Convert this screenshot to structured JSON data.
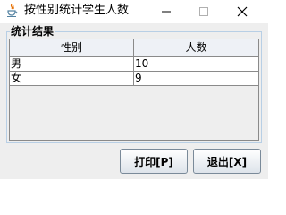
{
  "window": {
    "title": "按性别统计学生人数",
    "app_icon": "java-cup-icon",
    "controls": [
      "minimize-icon",
      "maximize-icon",
      "close-icon"
    ]
  },
  "group": {
    "label": "统计结果"
  },
  "table": {
    "columns": [
      "性别",
      "人数"
    ],
    "rows": [
      [
        "男",
        "10"
      ],
      [
        "女",
        "9"
      ]
    ]
  },
  "buttons": {
    "print_label": "打印[P]",
    "exit_label": "退出[X]"
  },
  "colors": {
    "panel_bg": "#eeeeee",
    "group_border": "#b8cfe5",
    "grid_line": "#8a8a8a",
    "java_red": "#e76f00",
    "java_blue": "#5382a1"
  }
}
